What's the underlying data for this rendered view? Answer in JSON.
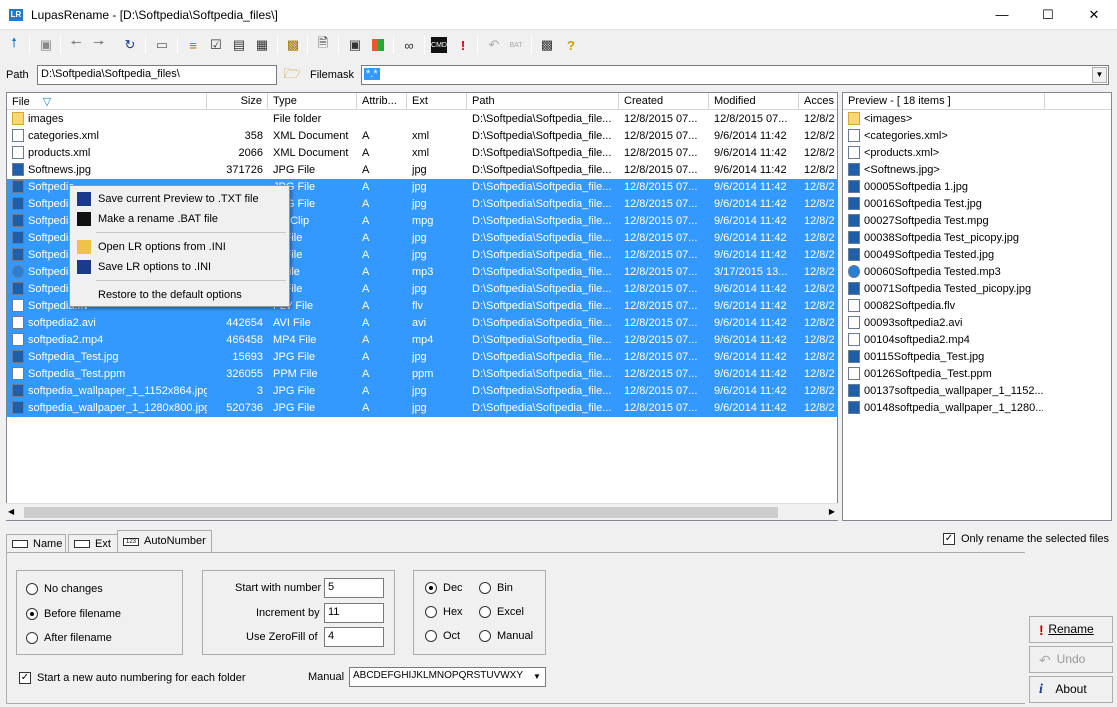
{
  "window": {
    "title": "LupasRename - [D:\\Softpedia\\Softpedia_files\\]",
    "app_icon": "LR"
  },
  "toolbar": {
    "icons": [
      "up-arrow-icon",
      "hold-icon",
      "back-icon",
      "forward-icon",
      "refresh-icon",
      "drive-icon",
      "view-list-icon",
      "check-list-icon",
      "details-icon",
      "grid-icon",
      "filter-icon",
      "document-icon",
      "image-preview-icon",
      "colors-icon",
      "stats-icon",
      "cmd-bat-icon",
      "exclamation-icon",
      "undo-icon",
      "save-bat-icon",
      "help-book-icon",
      "help-icon"
    ]
  },
  "path": {
    "label": "Path",
    "value": "D:\\Softpedia\\Softpedia_files\\",
    "filemask_label": "Filemask",
    "filemask_value": "*.*"
  },
  "columns": [
    "File",
    "Size",
    "Type",
    "Attrib...",
    "Ext",
    "Path",
    "Created",
    "Modified",
    "Acces"
  ],
  "files": [
    {
      "name": "images",
      "size": "",
      "type": "File folder",
      "attrib": "",
      "ext": "",
      "path": "D:\\Softpedia\\Softpedia_file...",
      "created": "12/8/2015 07...",
      "modified": "12/8/2015 07...",
      "access": "12/8/2",
      "icon": "folder",
      "selected": false
    },
    {
      "name": "categories.xml",
      "size": "358",
      "type": "XML Document",
      "attrib": "A",
      "ext": "xml",
      "path": "D:\\Softpedia\\Softpedia_file...",
      "created": "12/8/2015 07...",
      "modified": "9/6/2014 11:42",
      "access": "12/8/2",
      "icon": "doc",
      "selected": false
    },
    {
      "name": "products.xml",
      "size": "2066",
      "type": "XML Document",
      "attrib": "A",
      "ext": "xml",
      "path": "D:\\Softpedia\\Softpedia_file...",
      "created": "12/8/2015 07...",
      "modified": "9/6/2014 11:42",
      "access": "12/8/2",
      "icon": "doc",
      "selected": false
    },
    {
      "name": "Softnews.jpg",
      "size": "371726",
      "type": "JPG File",
      "attrib": "A",
      "ext": "jpg",
      "path": "D:\\Softpedia\\Softpedia_file...",
      "created": "12/8/2015 07...",
      "modified": "9/6/2014 11:42",
      "access": "12/8/2",
      "icon": "img",
      "selected": false
    },
    {
      "name": "Softpedia",
      "size": "",
      "type": "JPG File",
      "attrib": "A",
      "ext": "jpg",
      "path": "D:\\Softpedia\\Softpedia_file...",
      "created": "12/8/2015 07...",
      "modified": "9/6/2014 11:42",
      "access": "12/8/2",
      "icon": "img",
      "selected": true
    },
    {
      "name": "Softpedia",
      "size": "",
      "type": "JPG File",
      "attrib": "A",
      "ext": "jpg",
      "path": "D:\\Softpedia\\Softpedia_file...",
      "created": "12/8/2015 07...",
      "modified": "9/6/2014 11:42",
      "access": "12/8/2",
      "icon": "img",
      "selected": true
    },
    {
      "name": "Softpedia",
      "size": "",
      "type": "vie Clip",
      "attrib": "A",
      "ext": "mpg",
      "path": "D:\\Softpedia\\Softpedia_file...",
      "created": "12/8/2015 07...",
      "modified": "9/6/2014 11:42",
      "access": "12/8/2",
      "icon": "img",
      "selected": true
    },
    {
      "name": "Softpedia",
      "size": "",
      "type": "G File",
      "attrib": "A",
      "ext": "jpg",
      "path": "D:\\Softpedia\\Softpedia_file...",
      "created": "12/8/2015 07...",
      "modified": "9/6/2014 11:42",
      "access": "12/8/2",
      "icon": "img",
      "selected": true
    },
    {
      "name": "Softpedia",
      "size": "",
      "type": "G File",
      "attrib": "A",
      "ext": "jpg",
      "path": "D:\\Softpedia\\Softpedia_file...",
      "created": "12/8/2015 07...",
      "modified": "9/6/2014 11:42",
      "access": "12/8/2",
      "icon": "img",
      "selected": true
    },
    {
      "name": "Softpedia",
      "size": "",
      "type": "3 File",
      "attrib": "A",
      "ext": "mp3",
      "path": "D:\\Softpedia\\Softpedia_file...",
      "created": "12/8/2015 07...",
      "modified": "3/17/2015 13...",
      "access": "12/8/2",
      "icon": "audio",
      "selected": true
    },
    {
      "name": "Softpedia",
      "size": "",
      "type": "G File",
      "attrib": "A",
      "ext": "jpg",
      "path": "D:\\Softpedia\\Softpedia_file...",
      "created": "12/8/2015 07...",
      "modified": "9/6/2014 11:42",
      "access": "12/8/2",
      "icon": "img",
      "selected": true
    },
    {
      "name": "Softpedia.flv",
      "size": "",
      "type": "FLV File",
      "attrib": "A",
      "ext": "flv",
      "path": "D:\\Softpedia\\Softpedia_file...",
      "created": "12/8/2015 07...",
      "modified": "9/6/2014 11:42",
      "access": "12/8/2",
      "icon": "doc",
      "selected": true
    },
    {
      "name": "softpedia2.avi",
      "size": "442654",
      "type": "AVI File",
      "attrib": "A",
      "ext": "avi",
      "path": "D:\\Softpedia\\Softpedia_file...",
      "created": "12/8/2015 07...",
      "modified": "9/6/2014 11:42",
      "access": "12/8/2",
      "icon": "doc",
      "selected": true
    },
    {
      "name": "softpedia2.mp4",
      "size": "466458",
      "type": "MP4 File",
      "attrib": "A",
      "ext": "mp4",
      "path": "D:\\Softpedia\\Softpedia_file...",
      "created": "12/8/2015 07...",
      "modified": "9/6/2014 11:42",
      "access": "12/8/2",
      "icon": "doc",
      "selected": true
    },
    {
      "name": "Softpedia_Test.jpg",
      "size": "15693",
      "type": "JPG File",
      "attrib": "A",
      "ext": "jpg",
      "path": "D:\\Softpedia\\Softpedia_file...",
      "created": "12/8/2015 07...",
      "modified": "9/6/2014 11:42",
      "access": "12/8/2",
      "icon": "img",
      "selected": true
    },
    {
      "name": "Softpedia_Test.ppm",
      "size": "326055",
      "type": "PPM File",
      "attrib": "A",
      "ext": "ppm",
      "path": "D:\\Softpedia\\Softpedia_file...",
      "created": "12/8/2015 07...",
      "modified": "9/6/2014 11:42",
      "access": "12/8/2",
      "icon": "doc",
      "selected": true
    },
    {
      "name": "softpedia_wallpaper_1_1152x864.jpg",
      "size": "3",
      "type": "JPG File",
      "attrib": "A",
      "ext": "jpg",
      "path": "D:\\Softpedia\\Softpedia_file...",
      "created": "12/8/2015 07...",
      "modified": "9/6/2014 11:42",
      "access": "12/8/2",
      "icon": "img",
      "selected": true
    },
    {
      "name": "softpedia_wallpaper_1_1280x800.jpg",
      "size": "520736",
      "type": "JPG File",
      "attrib": "A",
      "ext": "jpg",
      "path": "D:\\Softpedia\\Softpedia_file...",
      "created": "12/8/2015 07...",
      "modified": "9/6/2014 11:42",
      "access": "12/8/2",
      "icon": "img",
      "selected": true
    }
  ],
  "context_menu": [
    {
      "label": "Save current Preview to .TXT file",
      "icon": "floppy-icon"
    },
    {
      "label": "Make a rename .BAT file",
      "icon": "cmd-bat-icon"
    },
    {
      "label": "Open LR options from .INI",
      "icon": "open-folder-icon"
    },
    {
      "label": "Save LR options to .INI",
      "icon": "floppy-icon"
    },
    {
      "label": "Restore to the default options",
      "icon": ""
    }
  ],
  "preview": {
    "header": "Preview - [ 18 items ]",
    "items": [
      {
        "name": "<images>",
        "icon": "folder"
      },
      {
        "name": "<categories.xml>",
        "icon": "doc"
      },
      {
        "name": "<products.xml>",
        "icon": "doc"
      },
      {
        "name": "<Softnews.jpg>",
        "icon": "img"
      },
      {
        "name": "00005Softpedia 1.jpg",
        "icon": "img"
      },
      {
        "name": "00016Softpedia Test.jpg",
        "icon": "img"
      },
      {
        "name": "00027Softpedia Test.mpg",
        "icon": "img"
      },
      {
        "name": "00038Softpedia Test_picopy.jpg",
        "icon": "img"
      },
      {
        "name": "00049Softpedia Tested.jpg",
        "icon": "img"
      },
      {
        "name": "00060Softpedia Tested.mp3",
        "icon": "audio"
      },
      {
        "name": "00071Softpedia Tested_picopy.jpg",
        "icon": "img"
      },
      {
        "name": "00082Softpedia.flv",
        "icon": "doc"
      },
      {
        "name": "00093softpedia2.avi",
        "icon": "doc"
      },
      {
        "name": "00104softpedia2.mp4",
        "icon": "doc"
      },
      {
        "name": "00115Softpedia_Test.jpg",
        "icon": "img"
      },
      {
        "name": "00126Softpedia_Test.ppm",
        "icon": "doc"
      },
      {
        "name": "00137softpedia_wallpaper_1_1152...",
        "icon": "img"
      },
      {
        "name": "00148softpedia_wallpaper_1_1280...",
        "icon": "img"
      }
    ]
  },
  "tabs": [
    "Name",
    "Ext",
    "AutoNumber"
  ],
  "only_selected_label": "Only rename the selected files",
  "position_options": [
    "No changes",
    "Before filename",
    "After filename"
  ],
  "numbering": {
    "start_label": "Start with number",
    "start_value": "5",
    "inc_label": "Increment by",
    "inc_value": "11",
    "zero_label": "Use ZeroFill of",
    "zero_value": "4"
  },
  "format_options": [
    "Dec",
    "Bin",
    "Hex",
    "Excel",
    "Oct",
    "Manual"
  ],
  "new_per_folder_label": "Start a new auto numbering for each folder",
  "manual_label": "Manual",
  "manual_value": "ABCDEFGHIJKLMNOPQRSTUVWXY",
  "buttons": {
    "rename": "Rename",
    "undo": "Undo",
    "about": "About"
  },
  "colors": {
    "selection": "#3399ff",
    "window": "#f0f0f0"
  }
}
